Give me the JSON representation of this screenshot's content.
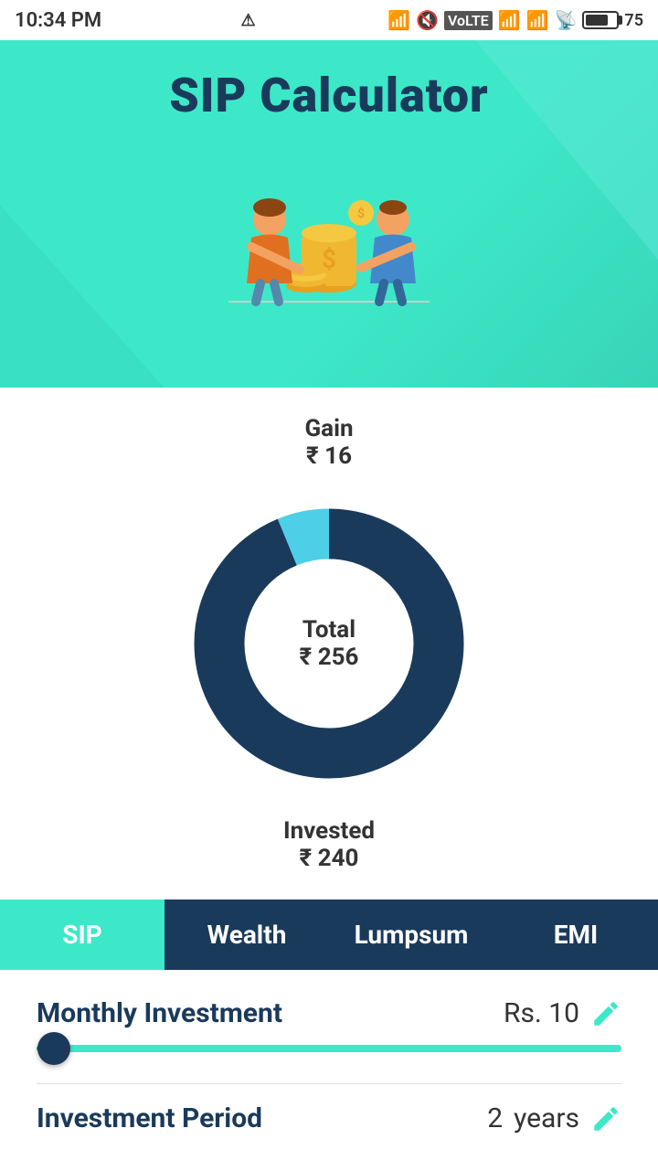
{
  "statusBar": {
    "time": "10:34 PM",
    "batteryLevel": 75
  },
  "header": {
    "title": "SIP Calculator"
  },
  "chart": {
    "gainLabel": "Gain",
    "gainValue": "₹ 16",
    "totalLabel": "Total",
    "totalValue": "₹ 256",
    "investedLabel": "Invested",
    "investedValue": "₹ 240",
    "investedAmount": 240,
    "gainAmount": 16,
    "totalAmount": 256,
    "investedColor": "#1a3a5c",
    "gainColor": "#4dcfe8"
  },
  "tabs": [
    {
      "label": "SIP",
      "active": true
    },
    {
      "label": "Wealth",
      "active": false
    },
    {
      "label": "Lumpsum",
      "active": false
    },
    {
      "label": "EMI",
      "active": false
    }
  ],
  "form": {
    "monthlyInvestment": {
      "label": "Monthly Investment",
      "value": "Rs. 10",
      "sliderMin": 1,
      "sliderMax": 10000,
      "sliderValue": 10
    },
    "investmentPeriod": {
      "label": "Investment Period",
      "value": "2",
      "unit": "years"
    }
  },
  "icons": {
    "edit": "✏️",
    "bluetooth": "⚡",
    "wifi": "📶"
  }
}
